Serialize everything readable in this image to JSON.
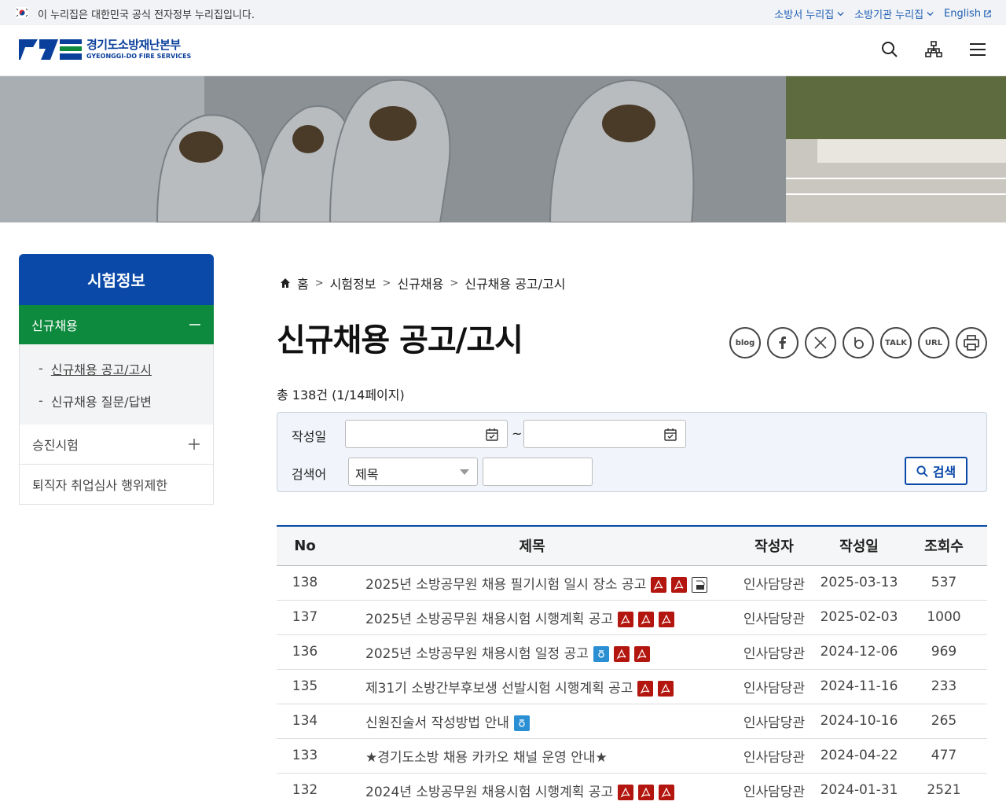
{
  "gov_bar": {
    "text": "이 누리집은 대한민국 공식 전자정부 누리집입니다.",
    "links": [
      "소방서 누리집",
      "소방기관 누리집",
      "English"
    ]
  },
  "header": {
    "logo_ko": "경기도소방재난본부",
    "logo_en": "GYEONGGI-DO FIRE SERVICES",
    "icons": [
      "search-icon",
      "sitemap-icon",
      "menu-icon"
    ]
  },
  "sidebar": {
    "title": "시험정보",
    "active": "신규채용",
    "sub": [
      "신규채용 공고/고시",
      "신규채용 질문/답변"
    ],
    "items": [
      "승진시험",
      "퇴직자 취업심사 행위제한"
    ]
  },
  "breadcrumb": [
    "홈",
    "시험정보",
    "신규채용",
    "신규채용 공고/고시"
  ],
  "page_title": "신규채용 공고/고시",
  "share": [
    "blog",
    "facebook",
    "x",
    "band",
    "TALK",
    "URL",
    "print"
  ],
  "total": "총 138건   (1/14페이지)",
  "search": {
    "date_label": "작성일",
    "tilde": "~",
    "kw_label": "검색어",
    "select_value": "제목",
    "button": "검색"
  },
  "table": {
    "headers": [
      "No",
      "제목",
      "작성자",
      "작성일",
      "조회수"
    ],
    "rows": [
      {
        "no": "138",
        "title": "2025년 소방공무원 채용 필기시험 일시 장소 공고",
        "files": [
          "pdf",
          "pdf",
          "file"
        ],
        "writer": "인사담당관",
        "date": "2025-03-13",
        "views": "537"
      },
      {
        "no": "137",
        "title": "2025년 소방공무원 채용시험 시행계획 공고",
        "files": [
          "pdf",
          "pdf",
          "pdf"
        ],
        "writer": "인사담당관",
        "date": "2025-02-03",
        "views": "1000"
      },
      {
        "no": "136",
        "title": "2025년 소방공무원 채용시험 일정 공고",
        "files": [
          "hwp",
          "pdf",
          "pdf"
        ],
        "writer": "인사담당관",
        "date": "2024-12-06",
        "views": "969"
      },
      {
        "no": "135",
        "title": "제31기 소방간부후보생 선발시험 시행계획 공고",
        "files": [
          "pdf",
          "pdf"
        ],
        "writer": "인사담당관",
        "date": "2024-11-16",
        "views": "233"
      },
      {
        "no": "134",
        "title": "신원진술서 작성방법 안내",
        "files": [
          "hwp"
        ],
        "writer": "인사담당관",
        "date": "2024-10-16",
        "views": "265"
      },
      {
        "no": "133",
        "title": "★경기도소방 채용 카카오 채널 운영 안내★",
        "files": [],
        "writer": "인사담당관",
        "date": "2024-04-22",
        "views": "477"
      },
      {
        "no": "132",
        "title": "2024년 소방공무원 채용시험 시행계획 공고",
        "files": [
          "pdf",
          "pdf",
          "pdf"
        ],
        "writer": "인사담당관",
        "date": "2024-01-31",
        "views": "2521"
      }
    ]
  }
}
